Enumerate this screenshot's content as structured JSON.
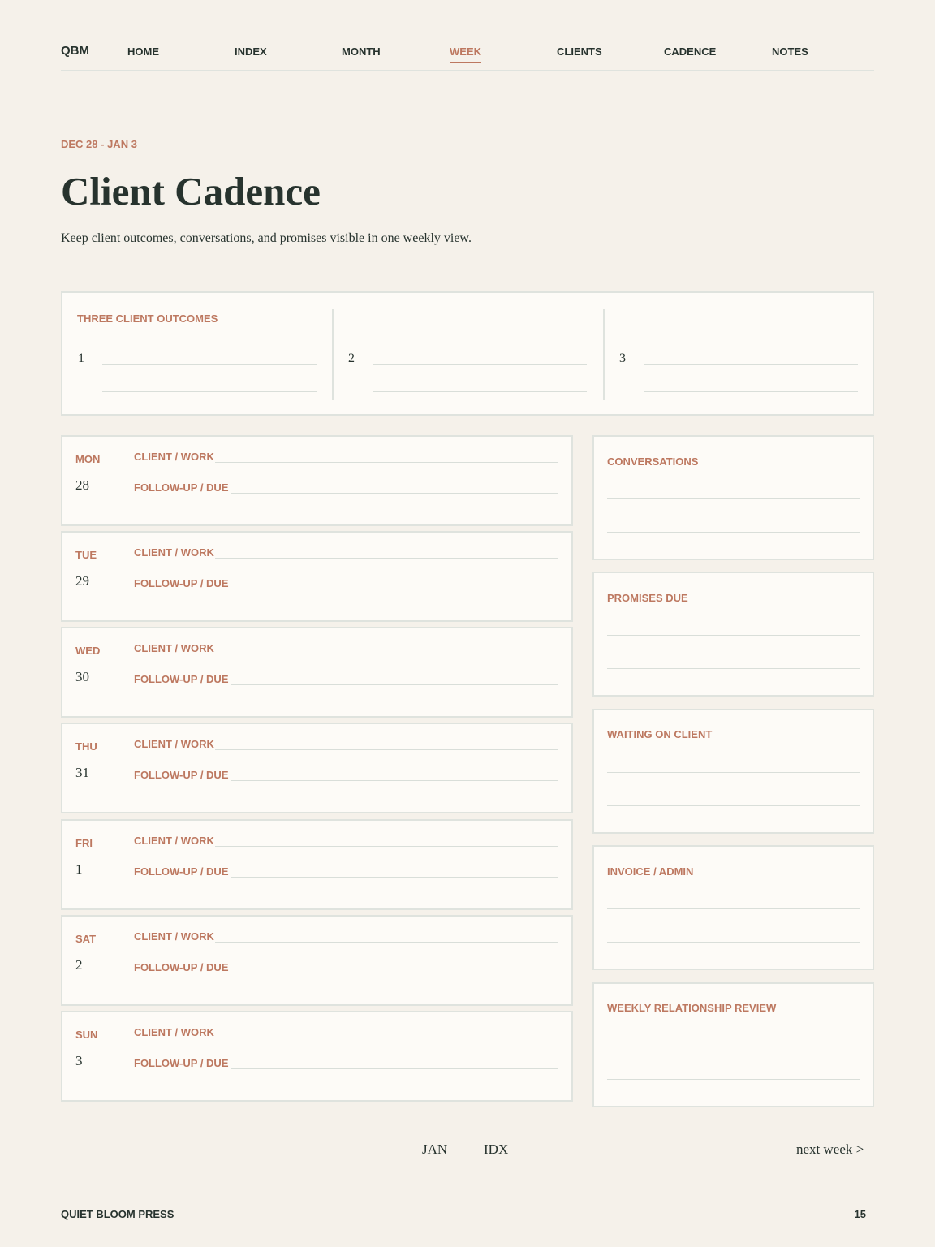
{
  "nav": {
    "brand": "QBM",
    "items": [
      {
        "label": "HOME"
      },
      {
        "label": "INDEX"
      },
      {
        "label": "MONTH"
      },
      {
        "label": "WEEK",
        "active": true
      },
      {
        "label": "CLIENTS"
      },
      {
        "label": "CADENCE"
      },
      {
        "label": "NOTES"
      }
    ]
  },
  "header": {
    "date_range": "DEC 28 - JAN 3",
    "title": "Client Cadence",
    "subtitle": "Keep client outcomes, conversations, and promises visible in one weekly view."
  },
  "outcomes": {
    "label": "THREE CLIENT OUTCOMES",
    "numbers": [
      "1",
      "2",
      "3"
    ]
  },
  "days": [
    {
      "name": "MON",
      "num": "28"
    },
    {
      "name": "TUE",
      "num": "29"
    },
    {
      "name": "WED",
      "num": "30"
    },
    {
      "name": "THU",
      "num": "31"
    },
    {
      "name": "FRI",
      "num": "1"
    },
    {
      "name": "SAT",
      "num": "2"
    },
    {
      "name": "SUN",
      "num": "3"
    }
  ],
  "day_fields": {
    "work": "CLIENT / WORK",
    "followup": "FOLLOW-UP / DUE"
  },
  "side_panels": [
    {
      "label": "CONVERSATIONS"
    },
    {
      "label": "PROMISES DUE"
    },
    {
      "label": "WAITING ON CLIENT"
    },
    {
      "label": "INVOICE / ADMIN"
    },
    {
      "label": "WEEKLY RELATIONSHIP REVIEW"
    }
  ],
  "footer_nav": {
    "month": "JAN",
    "index": "IDX",
    "next": "next week >"
  },
  "footer": {
    "publisher": "QUIET BLOOM PRESS",
    "page": "15"
  },
  "colors": {
    "background": "#f5f1ea",
    "accent": "#bd7860",
    "text": "#27332e",
    "rule": "#dfe3de",
    "panel": "#fdfbf7"
  }
}
